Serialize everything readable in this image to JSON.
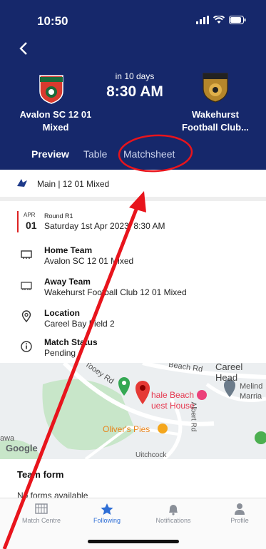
{
  "status_bar": {
    "time": "10:50"
  },
  "match": {
    "countdown": "in 10 days",
    "kickoff_time": "8:30 AM",
    "home_team_line1": "Avalon SC 12 01",
    "home_team_line2": "Mixed",
    "away_team_line1": "Wakehurst",
    "away_team_line2": "Football Club..."
  },
  "tabs": [
    "Preview",
    "Table",
    "Matchsheet"
  ],
  "competition": "Main | 12 01 Mixed",
  "round": {
    "month": "APR",
    "day": "01",
    "label": "Round R1",
    "datetime": "Saturday 1st Apr 2023, 8:30 AM"
  },
  "details": [
    {
      "title": "Home Team",
      "value": "Avalon SC 12 01 Mixed"
    },
    {
      "title": "Away Team",
      "value": "Wakehurst Football Club 12 01 Mixed"
    },
    {
      "title": "Location",
      "value": "Careel Bay Field 2"
    },
    {
      "title": "Match Status",
      "value": "Pending"
    }
  ],
  "map": {
    "road_1": "Careel Head",
    "road_2": "Beach Rd",
    "road_3": "Tooey Rd",
    "road_4": "Albert Rd",
    "place_1": "Whale Beach Guest House",
    "place_1_line1": "hale Beach",
    "place_1_line2": "uest House",
    "place_2": "Oliver's Pies",
    "place_3_line1": "Melind",
    "place_3_line2": "Marria",
    "watermark": "Google",
    "edge_label_1": "awa",
    "edge_label_2": "Uitchcock"
  },
  "team_form": {
    "title": "Team form",
    "empty": "No forms available"
  },
  "tabbar": [
    "Match Centre",
    "Following",
    "Notifications",
    "Profile"
  ],
  "colors": {
    "header_bg": "#16286b",
    "accent": "#2f6fd6",
    "annotation": "#e8141c"
  }
}
